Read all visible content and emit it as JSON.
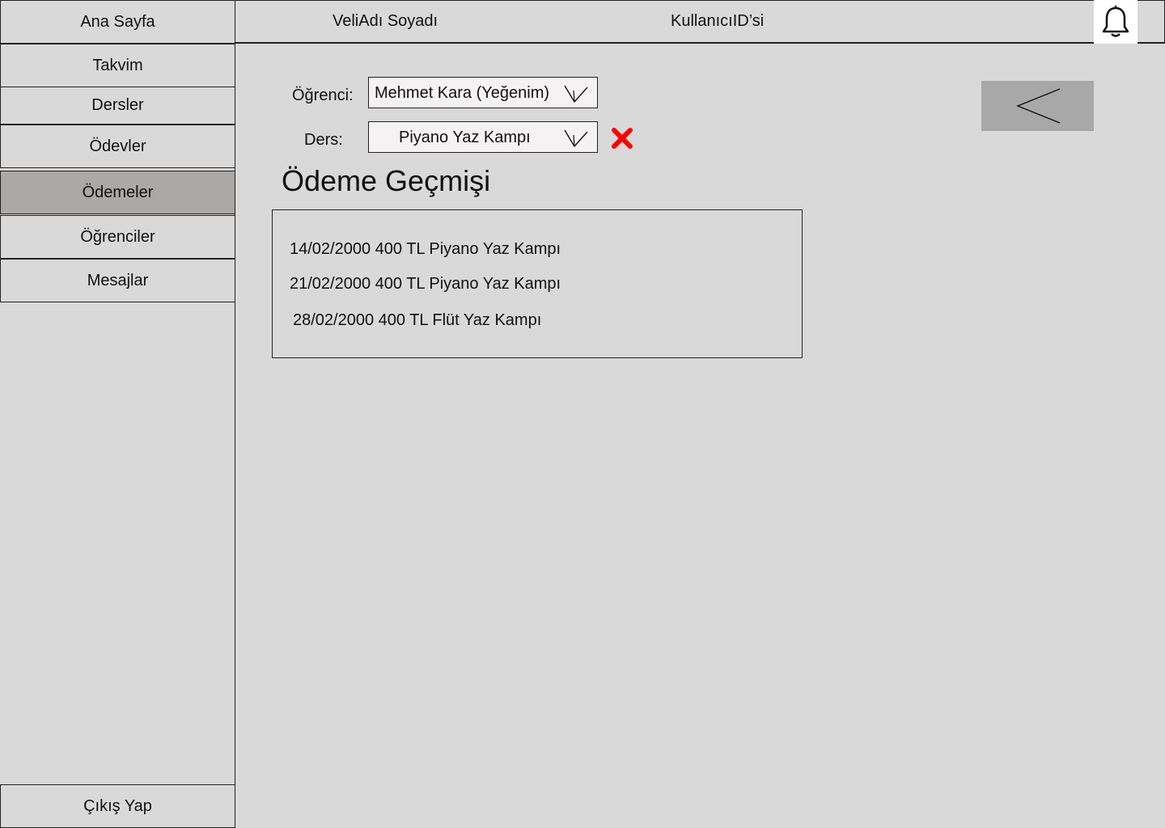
{
  "sidebar": {
    "items": [
      {
        "label": "Ana Sayfa"
      },
      {
        "label": "Takvim"
      },
      {
        "label": "Dersler"
      },
      {
        "label": "Ödevler"
      },
      {
        "label": "Ödemeler"
      },
      {
        "label": "Öğrenciler"
      },
      {
        "label": "Mesajlar"
      }
    ],
    "active_index": 4,
    "logout_label": "Çıkış Yap"
  },
  "header": {
    "parent_name": "VeliAdı Soyadı",
    "user_id": "KullanıcıID’si",
    "notification_icon": "bell-icon"
  },
  "filters": {
    "student_label": "Öğrenci:",
    "student_value": "Mehmet Kara (Yeğenim)",
    "course_label": "Ders:",
    "course_value": "Piyano Yaz Kampı",
    "dropdown_icon": "chevron-down-icon",
    "clear_icon": "close-icon",
    "clear_color": "#ff0000"
  },
  "back_icon": "back-arrow-icon",
  "payment_history": {
    "title": "Ödeme Geçmişi",
    "rows": [
      "14/02/2000 400 TL Piyano Yaz Kampı",
      "21/02/2000 400 TL Piyano Yaz Kampı",
      "28/02/2000 400 TL Flüt Yaz Kampı"
    ]
  }
}
